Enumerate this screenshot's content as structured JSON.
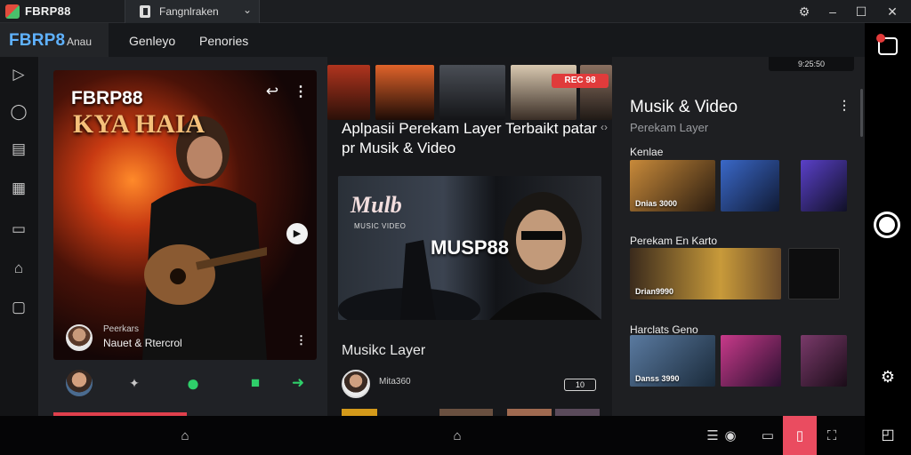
{
  "titlebar": {
    "app_name": "FBRP88",
    "tab_title": "Fangnlraken",
    "controls": [
      "settings-icon",
      "minimize-icon",
      "maximize-icon",
      "close-icon"
    ]
  },
  "nav": {
    "logo": "FBRP8",
    "logo_sub": "Anau",
    "links": [
      "Genleyo",
      "Penories"
    ]
  },
  "sidebar": {
    "icons": [
      "play-icon",
      "chat-icon",
      "panel-icon",
      "grid-icon",
      "document-icon",
      "bell-icon",
      "window-icon"
    ]
  },
  "featured": {
    "brand": "FBRP88",
    "big_text": "KYA HAIA",
    "caption_small": "Peerkars",
    "caption_main": "Nauet & Rtercrol",
    "colors": {
      "glow": "#ff8a2a",
      "accent_green": "#2fcf6a",
      "accent_red": "#e0404c"
    }
  },
  "middle": {
    "rec_badge": "REC 98",
    "title": "Aplpasii Perekam Layer Terbaikt patar pr Musik & Video",
    "video_logo": "Mulb",
    "video_sub": "MUSIC VIDEO",
    "video_mark": "MUSP88",
    "section_title": "Musikc Layer",
    "user": "Mita360",
    "badge": "10"
  },
  "right": {
    "status": "9:25:50",
    "title": "Musik & Video",
    "subtitle": "Perekam Layer",
    "sections": [
      {
        "label": "Kenlae",
        "thumbs": [
          {
            "caption": "Dnias 3000"
          },
          {
            "caption": ""
          },
          {
            "caption": ""
          }
        ]
      },
      {
        "label": "Perekam En Karto",
        "thumbs": [
          {
            "caption": "Drian9990"
          },
          {
            "caption": ""
          }
        ]
      },
      {
        "label": "Harclats Geno",
        "thumbs": [
          {
            "caption": "Danss 3990"
          },
          {
            "caption": ""
          },
          {
            "caption": ""
          }
        ]
      }
    ]
  },
  "bottom": {
    "icons": [
      "back-icon",
      "home-icon",
      "home-icon",
      "list-icon",
      "message-icon",
      "window-icon",
      "fullscreen-icon"
    ],
    "active_color": "#ea4c60"
  },
  "rail": {
    "icons": [
      "record-icon",
      "camera-shutter-icon",
      "settings-icon",
      "window-icon"
    ]
  }
}
